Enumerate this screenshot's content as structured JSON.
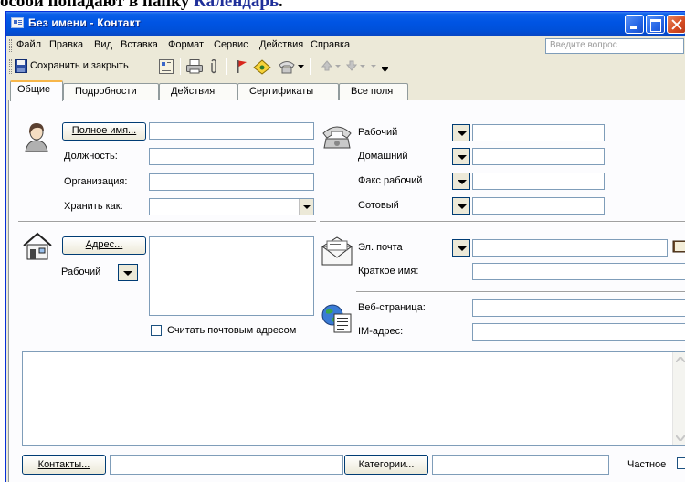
{
  "slide_top_text": {
    "prefix": "особи попадают в папку ",
    "accent": "Календарь"
  },
  "window": {
    "title": "Без имени - Контакт"
  },
  "menu": {
    "items": [
      "Файл",
      "Правка",
      "Вид",
      "Вставка",
      "Формат",
      "Сервис",
      "Действия",
      "Справка"
    ],
    "ask_placeholder": "Введите вопрос"
  },
  "toolbar": {
    "save_close": "Сохранить и закрыть"
  },
  "tabs": [
    "Общие",
    "Подробности",
    "Действия",
    "Сертификаты",
    "Все поля"
  ],
  "left": {
    "fullname_button": "Полное имя...",
    "job_title": "Должность:",
    "company": "Организация:",
    "file_as": "Хранить как:",
    "address_button": "Адрес...",
    "address_type": "Рабочий",
    "mailing_address": "Считать почтовым адресом"
  },
  "phones": {
    "business": "Рабочий",
    "home": "Домашний",
    "business_fax": "Факс рабочий",
    "mobile": "Сотовый"
  },
  "email": {
    "label": "Эл. почта",
    "display_as": "Краткое имя:"
  },
  "web": {
    "page": "Веб-страница:",
    "im": "IM-адрес:"
  },
  "bottom": {
    "contacts_button": "Контакты...",
    "categories_button": "Категории...",
    "private_label": "Частное"
  }
}
